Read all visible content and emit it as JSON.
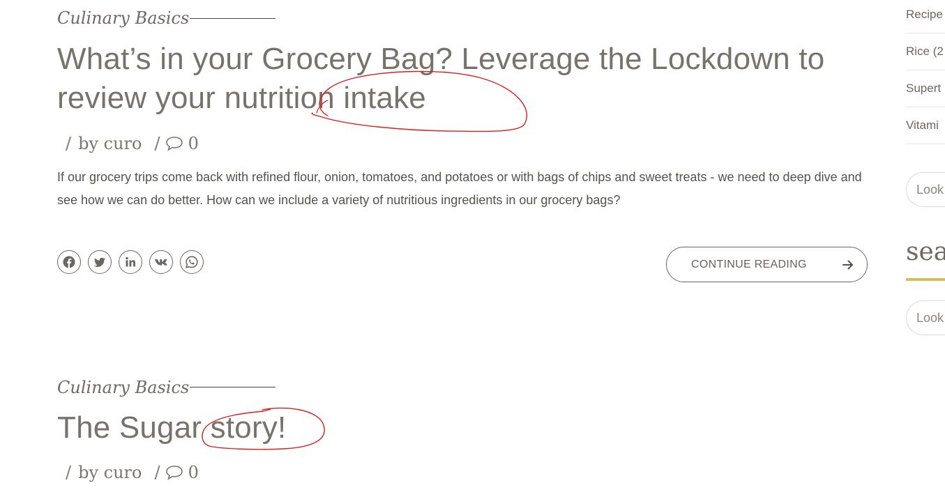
{
  "posts": [
    {
      "category": "Culinary Basics",
      "title_line1": "What’s in your Grocery Bag? Leverage the Lockdown to",
      "title_line2": "review your nutrition intake",
      "meta_sep": "/",
      "author": "by curo",
      "meta_sep2": "/",
      "comments": "0",
      "excerpt": "If our grocery trips come back with refined flour, onion, tomatoes, and potatoes or with bags of chips and sweet treats - we need to deep dive and see how we can do better. How can we include a variety of nutritious ingredients in our grocery bags?",
      "share_icons": [
        "facebook-icon",
        "twitter-icon",
        "linkedin-icon",
        "vk-icon",
        "whatsapp-icon"
      ],
      "continue_label": "CONTINUE READING"
    },
    {
      "category": "Culinary Basics",
      "title": "The Sugar story!",
      "meta_sep": "/",
      "author": "by curo",
      "meta_sep2": "/",
      "comments": "0"
    }
  ],
  "sidebar": {
    "categories": [
      "Recipe",
      "Rice (2",
      "Supert",
      "Vitami"
    ],
    "search_placeholder_1": "Look",
    "search_heading": "sear",
    "search_placeholder_2": "Look"
  },
  "colors": {
    "text": "#7a766e",
    "accent_bar": "#d4c05a",
    "annotation": "#d42020"
  }
}
